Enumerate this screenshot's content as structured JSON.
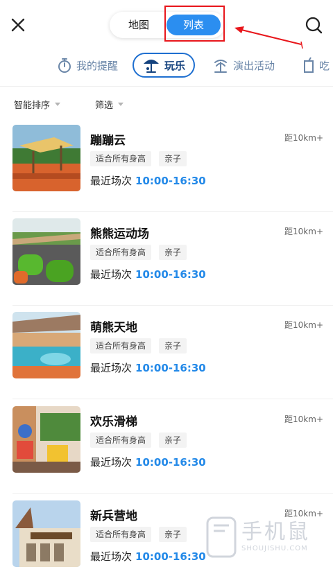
{
  "header": {
    "segments": {
      "map": "地图",
      "list": "列表"
    }
  },
  "categories": [
    {
      "label": "我的提醒",
      "icon": "stopwatch-icon"
    },
    {
      "label": "玩乐",
      "icon": "umbrella-icon",
      "active": true
    },
    {
      "label": "演出活动",
      "icon": "palm-tree-icon"
    },
    {
      "label": "吃",
      "icon": "drink-icon"
    }
  ],
  "sort": {
    "smart": "智能排序",
    "filter": "筛选"
  },
  "items": [
    {
      "name": "蹦蹦云",
      "distance": "距10km+",
      "tags": [
        "适合所有身高",
        "亲子"
      ],
      "recent_label": "最近场次",
      "time": "10:00-16:30"
    },
    {
      "name": "熊熊运动场",
      "distance": "距10km+",
      "tags": [
        "适合所有身高",
        "亲子"
      ],
      "recent_label": "最近场次",
      "time": "10:00-16:30"
    },
    {
      "name": "萌熊天地",
      "distance": "距10km+",
      "tags": [
        "适合所有身高",
        "亲子"
      ],
      "recent_label": "最近场次",
      "time": "10:00-16:30"
    },
    {
      "name": "欢乐滑梯",
      "distance": "距10km+",
      "tags": [
        "适合所有身高",
        "亲子"
      ],
      "recent_label": "最近场次",
      "time": "10:00-16:30"
    },
    {
      "name": "新兵营地",
      "distance": "距10km+",
      "tags": [
        "适合所有身高",
        "亲子"
      ],
      "recent_label": "最近场次",
      "time": "10:00-16:30"
    }
  ],
  "watermark": {
    "text": "手机鼠",
    "sub": "SHOUJISHU.COM"
  },
  "colors": {
    "accent": "#2b8ef0",
    "highlight": "#e8161b",
    "time": "#2389e8"
  }
}
